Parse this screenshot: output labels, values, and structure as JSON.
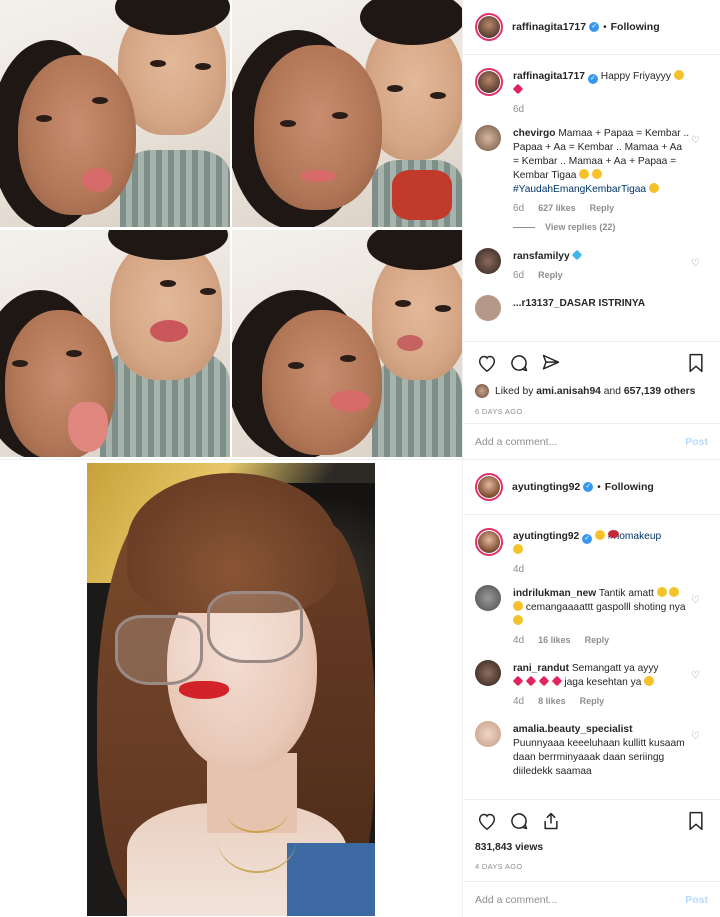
{
  "post1": {
    "username": "raffinagita1717",
    "follow_label": "Following",
    "dot": "•",
    "caption": {
      "username": "raffinagita1717",
      "text": "Happy Friyayyy",
      "time": "6d"
    },
    "comments": [
      {
        "username": "chevirgo",
        "text": "Mamaa + Papaa = Kembar .. Papaa + Aa = Kembar .. Mamaa + Aa = Kembar .. Mamaa + Aa + Papaa = Kembar Tigaa",
        "hashtag": "#YaudahEmangKembarTigaa",
        "time": "6d",
        "likes": "627 likes",
        "reply": "Reply",
        "view_replies": "View replies (22)"
      },
      {
        "username": "ransfamilyy",
        "text": "",
        "time": "6d",
        "reply": "Reply"
      },
      {
        "username": "...r13137_DASAR ISTRINYA",
        "text": ""
      }
    ],
    "liked_by_prefix": "Liked by",
    "liked_by_user": "ami.anisah94",
    "liked_by_suffix": "and",
    "liked_by_count": "657,139 others",
    "time_ago": "6 DAYS AGO",
    "add_comment_placeholder": "Add a comment...",
    "post_button": "Post"
  },
  "post2": {
    "username": "ayutingting92",
    "follow_label": "Following",
    "dot": "•",
    "caption": {
      "username": "ayutingting92",
      "hashtag": "#nomakeup",
      "time": "4d"
    },
    "comments": [
      {
        "username": "indrilukman_new",
        "text": "Tantik amatt",
        "text2": "cemangaaaattt gaspolll shoting nya",
        "time": "4d",
        "likes": "16 likes",
        "reply": "Reply"
      },
      {
        "username": "rani_randut",
        "text": "Semangatt ya ayyy",
        "text2": "jaga kesehtan ya",
        "time": "4d",
        "likes": "8 likes",
        "reply": "Reply"
      },
      {
        "username": "amalia.beauty_specialist",
        "text": "Puunnyaaa keeeluhaan kullitt kusaam daan berrminyaaak daan seriingg diiledekk saamaa"
      }
    ],
    "views": "831,843 views",
    "time_ago": "4 DAYS AGO",
    "add_comment_placeholder": "Add a comment...",
    "post_button": "Post"
  },
  "icons": {
    "heart": "heart-icon",
    "comment": "comment-icon",
    "share": "share-icon",
    "save": "bookmark-icon"
  },
  "colors": {
    "verified": "#3897f0",
    "story_ring": "#e1306c",
    "hashtag": "#003569",
    "muted": "#8e8e8e",
    "post_disabled": "#b3dbff"
  }
}
